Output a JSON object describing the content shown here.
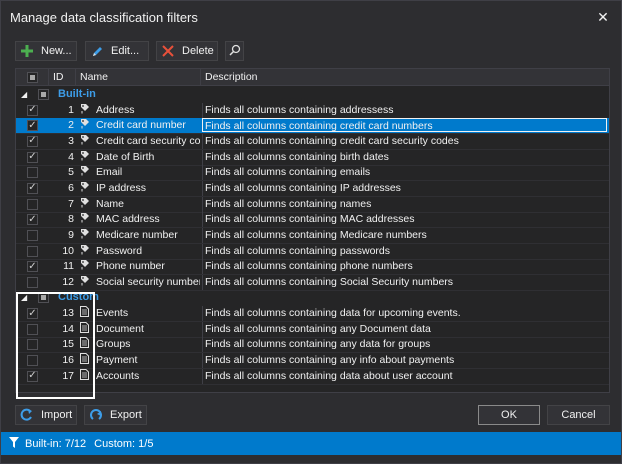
{
  "window": {
    "title": "Manage data classification filters"
  },
  "toolbar": {
    "new_label": "New...",
    "edit_label": "Edit...",
    "delete_label": "Delete"
  },
  "columns": {
    "id": "ID",
    "name": "Name",
    "description": "Description"
  },
  "groups": {
    "builtin": {
      "label": "Built-in",
      "rows": [
        {
          "checked": true,
          "id": "1",
          "name": "Address",
          "desc": "Finds all columns containing addressess"
        },
        {
          "checked": true,
          "id": "2",
          "name": "Credit card number",
          "desc": "Finds all columns containing credit card numbers",
          "selected": true
        },
        {
          "checked": true,
          "id": "3",
          "name": "Credit card security code",
          "desc": "Finds all columns containing credit card security codes"
        },
        {
          "checked": true,
          "id": "4",
          "name": "Date of Birth",
          "desc": "Finds all columns containing birth dates"
        },
        {
          "checked": false,
          "id": "5",
          "name": "Email",
          "desc": "Finds all columns containing emails"
        },
        {
          "checked": true,
          "id": "6",
          "name": "IP address",
          "desc": "Finds all columns containing IP addresses"
        },
        {
          "checked": false,
          "id": "7",
          "name": "Name",
          "desc": "Finds all columns containing names"
        },
        {
          "checked": true,
          "id": "8",
          "name": "MAC address",
          "desc": "Finds all columns containing MAC addresses"
        },
        {
          "checked": false,
          "id": "9",
          "name": "Medicare number",
          "desc": "Finds all columns containing Medicare numbers"
        },
        {
          "checked": false,
          "id": "10",
          "name": "Password",
          "desc": "Finds all columns containing passwords"
        },
        {
          "checked": true,
          "id": "11",
          "name": "Phone number",
          "desc": "Finds all columns containing phone numbers"
        },
        {
          "checked": false,
          "id": "12",
          "name": "Social security number",
          "desc": "Finds all columns containing Social Security numbers"
        }
      ]
    },
    "custom": {
      "label": "Custom",
      "rows": [
        {
          "checked": true,
          "id": "13",
          "name": "Events",
          "desc": "Finds all columns containing data for upcoming events."
        },
        {
          "checked": false,
          "id": "14",
          "name": "Document",
          "desc": "Finds all columns containing any Document data"
        },
        {
          "checked": false,
          "id": "15",
          "name": "Groups",
          "desc": "Finds all columns containing any data for groups"
        },
        {
          "checked": false,
          "id": "16",
          "name": "Payment",
          "desc": "Finds all columns containing any info about payments"
        },
        {
          "checked": true,
          "id": "17",
          "name": "Accounts",
          "desc": "Finds all columns containing data about user account"
        }
      ]
    }
  },
  "footer": {
    "import_label": "Import",
    "export_label": "Export",
    "ok_label": "OK",
    "cancel_label": "Cancel"
  },
  "status": {
    "builtin_text": "Built-in: 7/12",
    "custom_text": "Custom: 1/5"
  },
  "colors": {
    "accent": "#007acc",
    "group_label": "#3d9de8",
    "background": "#2d2d30"
  }
}
